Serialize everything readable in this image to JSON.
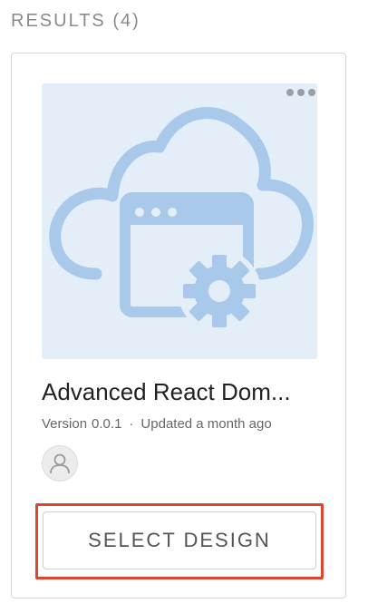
{
  "results": {
    "label": "RESULTS (4)"
  },
  "card": {
    "title": "Advanced React Dom...",
    "version_label": "Version",
    "version_value": "0.0.1",
    "separator": "·",
    "updated": "Updated a month ago",
    "thumbnail_icon": "cloud-window-gear-icon",
    "more_icon": "more-horizontal-icon",
    "avatar_icon": "user-avatar-icon",
    "select_label": "SELECT DESIGN"
  },
  "colors": {
    "thumbnail_bg": "#e3eef9",
    "illustration": "#a9c9ea",
    "highlight_border": "#e0462c"
  }
}
